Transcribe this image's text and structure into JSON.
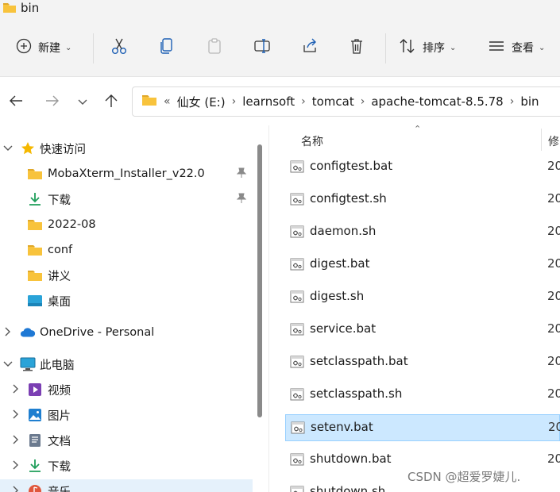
{
  "window": {
    "title": "bin"
  },
  "toolbar": {
    "new_label": "新建",
    "sort_label": "排序",
    "view_label": "查看"
  },
  "address": {
    "overflow": "«",
    "crumbs": [
      "仙女 (E:)",
      "learnsoft",
      "tomcat",
      "apache-tomcat-8.5.78",
      "bin"
    ]
  },
  "nav_tree": {
    "quick_access": "快速访问",
    "items": [
      {
        "label": "MobaXterm_Installer_v22.0",
        "pinned": true
      },
      {
        "label": "下载",
        "pinned": true
      },
      {
        "label": "2022-08",
        "pinned": false
      },
      {
        "label": "conf",
        "pinned": false
      },
      {
        "label": "讲义",
        "pinned": false
      },
      {
        "label": "桌面",
        "pinned": false
      }
    ],
    "onedrive": "OneDrive - Personal",
    "this_pc": "此电脑",
    "pc_items": [
      {
        "label": "视频"
      },
      {
        "label": "图片"
      },
      {
        "label": "文档"
      },
      {
        "label": "下载"
      },
      {
        "label": "音乐"
      }
    ]
  },
  "file_list": {
    "col_name": "名称",
    "col_modified": "修",
    "files": [
      {
        "name": "configtest.bat",
        "date": "20"
      },
      {
        "name": "configtest.sh",
        "date": "20"
      },
      {
        "name": "daemon.sh",
        "date": "20"
      },
      {
        "name": "digest.bat",
        "date": "20"
      },
      {
        "name": "digest.sh",
        "date": "20"
      },
      {
        "name": "service.bat",
        "date": "20"
      },
      {
        "name": "setclasspath.bat",
        "date": "20"
      },
      {
        "name": "setclasspath.sh",
        "date": "20"
      },
      {
        "name": "setenv.bat",
        "date": "20"
      },
      {
        "name": "shutdown.bat",
        "date": "20"
      },
      {
        "name": "shutdown.sh",
        "date": ""
      }
    ],
    "selected_index": 8
  },
  "watermark": "CSDN @超爱罗婕儿.",
  "colors": {
    "accent": "#0067c0",
    "folder": "#f8c33c",
    "selection": "#cce8ff",
    "selection_border": "#99d1ff"
  }
}
